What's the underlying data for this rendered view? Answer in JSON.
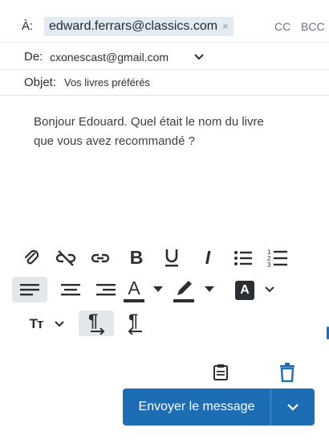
{
  "header": {
    "to_label": "À:",
    "to_recipient": "edward.ferrars@classics.com",
    "remove_recipient": "×",
    "cc_label": "CC",
    "bcc_label": "BCC",
    "from_label": "De:",
    "from_value": "cxonescast@gmail.com",
    "subject_label": "Objet:",
    "subject_value": "Vos livres préférés"
  },
  "message": {
    "body": "Bonjour Edouard. Quel était le nom du livre que vous avez recommandé ?"
  },
  "toolbar": {
    "bold_glyph": "B",
    "italic_glyph": "I",
    "underline_glyph": "U",
    "text_color_glyph": "A",
    "highlight_glyph": "A",
    "font_size_glyph": "Tт",
    "ltr_glyph": "¶",
    "rtl_glyph": "¶",
    "icons": [
      "attachment-icon",
      "unlink-icon",
      "link-icon",
      "bold-icon",
      "underline-icon",
      "italic-icon",
      "bullet-list-icon",
      "numbered-list-icon",
      "align-left-icon",
      "align-center-icon",
      "align-right-icon",
      "text-color-icon",
      "highlight-icon",
      "text-background-icon",
      "font-size-icon",
      "ltr-icon",
      "rtl-icon",
      "templates-icon",
      "delete-icon"
    ]
  },
  "actions": {
    "send_label": "Envoyer le message"
  },
  "colors": {
    "accent": "#1d6db5",
    "chip_bg": "#e3ebf3",
    "active_button_bg": "#e4e7ea",
    "icon": "#2b2f33"
  }
}
